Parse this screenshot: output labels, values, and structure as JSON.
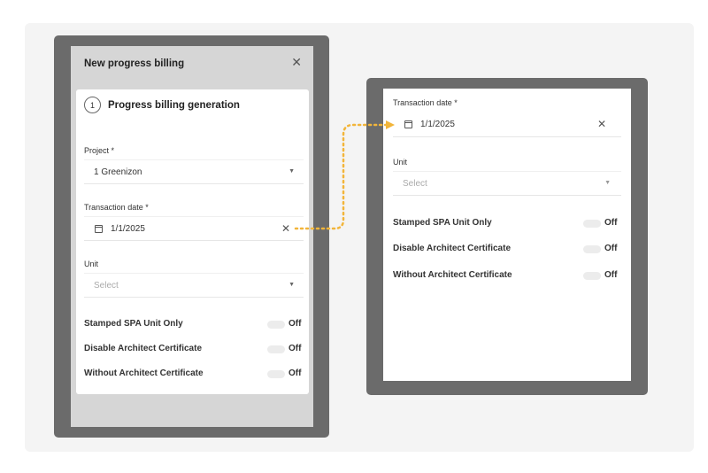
{
  "modal": {
    "title": "New progress billing",
    "close_icon": "close-icon",
    "step_number": "1",
    "step_title": "Progress billing generation"
  },
  "form": {
    "project_label": "Project *",
    "project_value": "1 Greenizon",
    "transaction_date_label": "Transaction date *",
    "transaction_date_value": "1/1/2025",
    "unit_label": "Unit",
    "unit_placeholder": "Select",
    "toggles": [
      {
        "label": "Stamped SPA Unit Only",
        "state": "Off"
      },
      {
        "label": "Disable Architect Certificate",
        "state": "Off"
      },
      {
        "label": "Without Architect Certificate",
        "state": "Off"
      }
    ]
  },
  "zoom": {
    "transaction_date_label": "Transaction date *",
    "transaction_date_value": "1/1/2025",
    "unit_label": "Unit",
    "unit_placeholder": "Select",
    "toggles": [
      {
        "label": "Stamped SPA Unit Only",
        "state": "Off"
      },
      {
        "label": "Disable Architect Certificate",
        "state": "Off"
      },
      {
        "label": "Without Architect Certificate",
        "state": "Off"
      }
    ]
  },
  "colors": {
    "frame": "#6b6b6b",
    "modal_bg": "#d6d6d6",
    "connector": "#f2b53a"
  }
}
